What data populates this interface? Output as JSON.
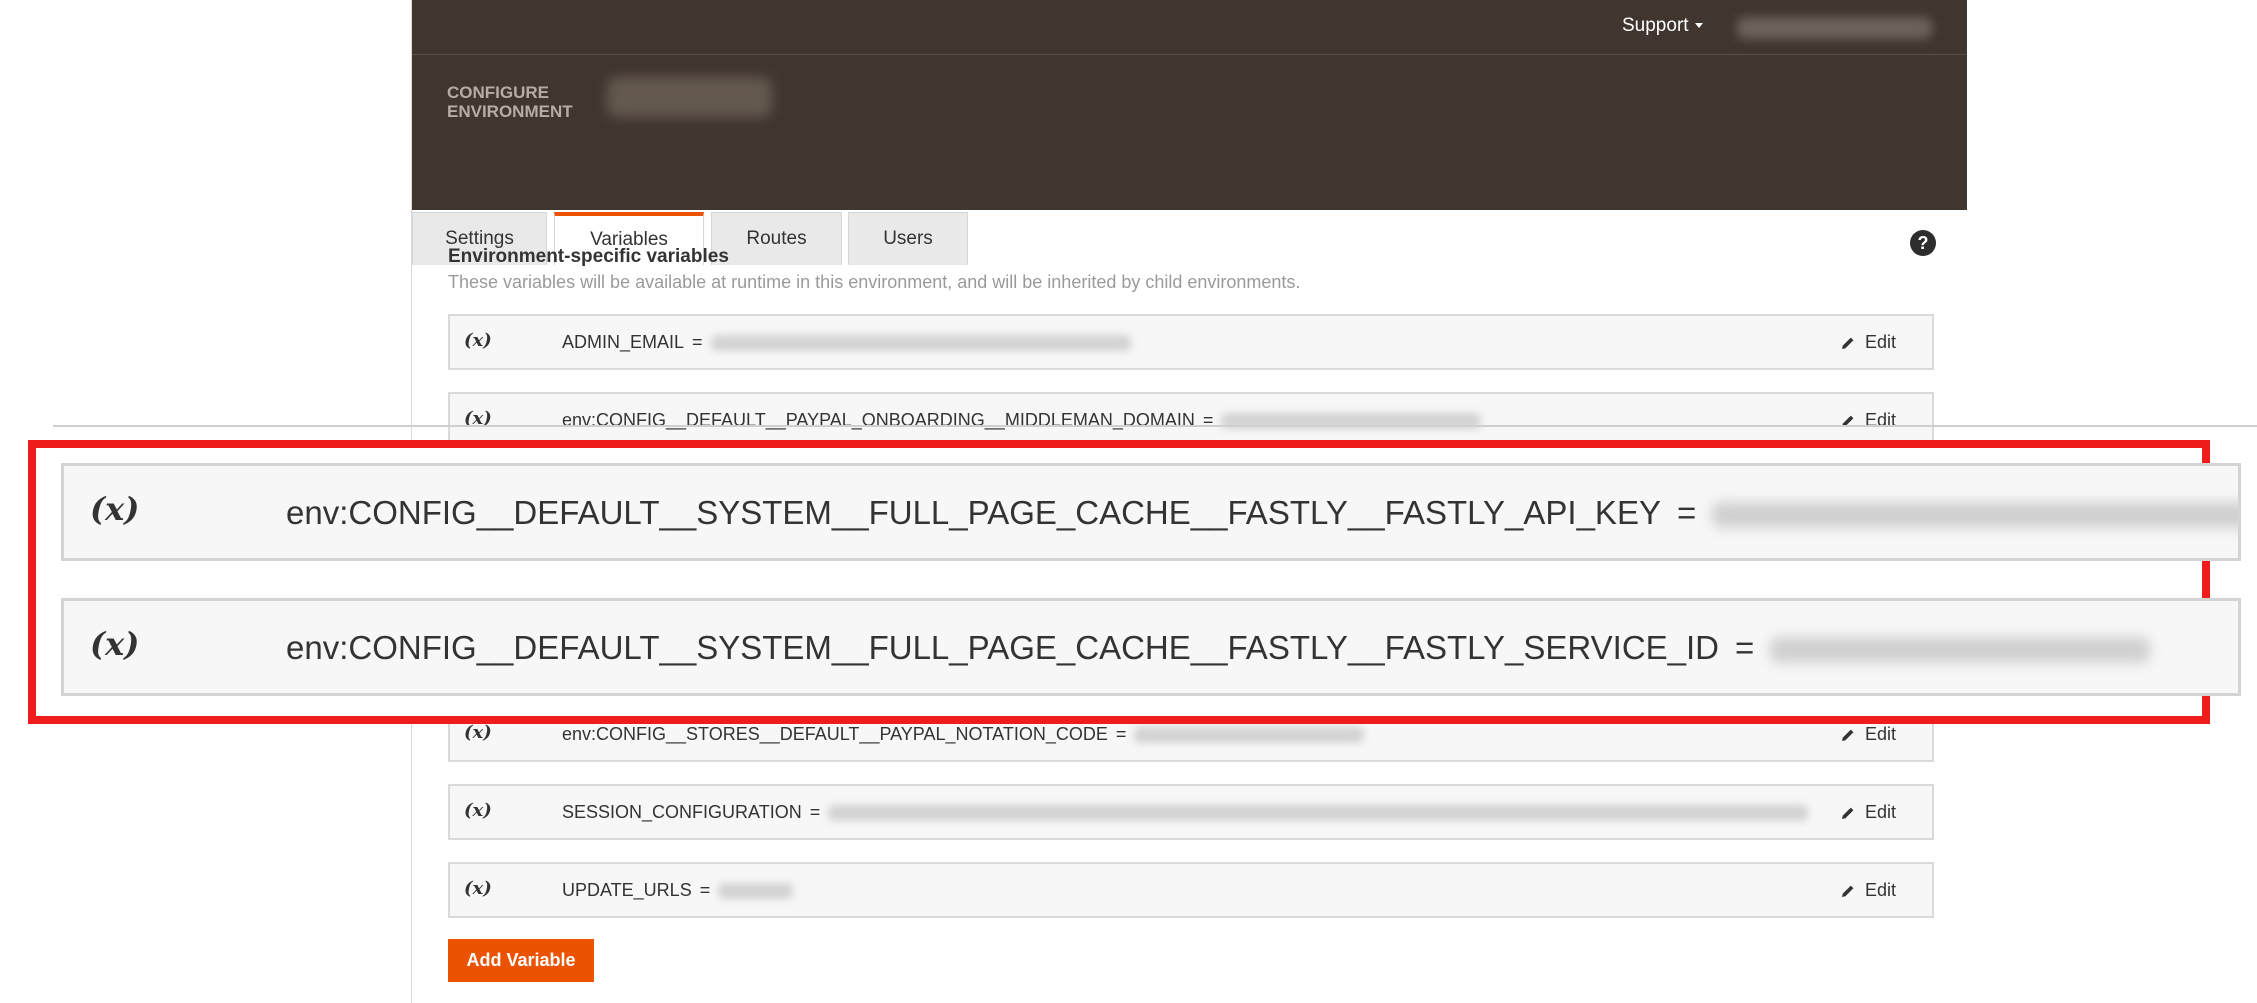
{
  "topbar": {
    "support_label": "Support"
  },
  "header": {
    "title": "CONFIGURE\nENVIRONMENT"
  },
  "tabs": [
    {
      "label": "Settings",
      "active": false
    },
    {
      "label": "Variables",
      "active": true
    },
    {
      "label": "Routes",
      "active": false
    },
    {
      "label": "Users",
      "active": false
    }
  ],
  "section": {
    "heading": "Environment-specific variables",
    "description": "These variables will be available at runtime in this environment, and will be inherited by child environments.",
    "help_glyph": "?"
  },
  "variables": [
    {
      "name": "ADMIN_EMAIL",
      "edit_label": "Edit"
    },
    {
      "name": "env:CONFIG__DEFAULT__PAYPAL_ONBOARDING__MIDDLEMAN_DOMAIN",
      "edit_label": "Edit"
    },
    {
      "name": "env:CONFIG__STORES__DEFAULT__PAYPAL_NOTATION_CODE",
      "edit_label": "Edit"
    },
    {
      "name": "SESSION_CONFIGURATION",
      "edit_label": "Edit"
    },
    {
      "name": "UPDATE_URLS",
      "edit_label": "Edit"
    }
  ],
  "variable_icon": "(x)",
  "equals_sign": "=",
  "add_button_label": "Add Variable",
  "zoom_callout": {
    "rows": [
      {
        "name": "env:CONFIG__DEFAULT__SYSTEM__FULL_PAGE_CACHE__FASTLY__FASTLY_API_KEY"
      },
      {
        "name": "env:CONFIG__DEFAULT__SYSTEM__FULL_PAGE_CACHE__FASTLY__FASTLY_SERVICE_ID"
      }
    ]
  },
  "colors": {
    "header_bg": "#41362f",
    "accent": "#eb5202",
    "callout_border": "#ef1c1c"
  },
  "icons": {
    "variable": "variable-icon",
    "edit": "pencil-icon",
    "help": "question-icon",
    "dropdown": "caret-down-icon"
  }
}
